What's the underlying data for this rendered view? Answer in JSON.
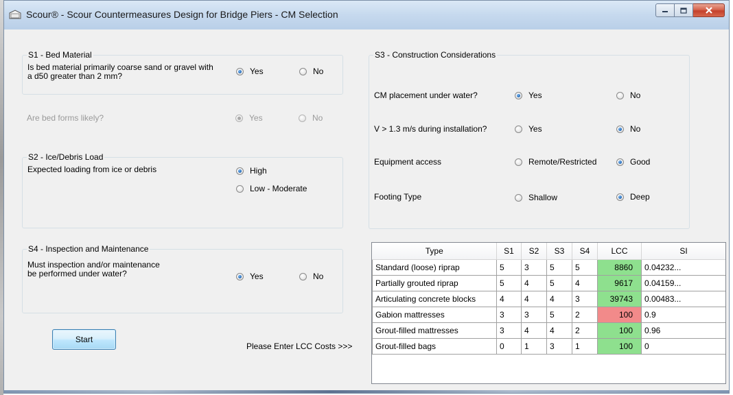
{
  "window": {
    "title": "Scour® - Scour Countermeasures Design for Bridge Piers  - CM Selection"
  },
  "s1": {
    "legend": "S1 - Bed Material",
    "question_line1": "Is bed material primarily coarse sand or gravel with",
    "question_line2": "a d50 greater than 2 mm?",
    "yes": "Yes",
    "no": "No",
    "selected": "Yes",
    "bedforms_question": "Are bed forms likely?",
    "bedforms_yes": "Yes",
    "bedforms_no": "No",
    "bedforms_selected": "Yes",
    "bedforms_enabled": false
  },
  "s2": {
    "legend": "S2 - Ice/Debris Load",
    "question": "Expected loading from ice or debris",
    "high": "High",
    "low": "Low - Moderate",
    "selected": "High"
  },
  "s3": {
    "legend": "S3 - Construction Considerations",
    "q1": "CM placement under water?",
    "q1_yes": "Yes",
    "q1_no": "No",
    "q1_selected": "Yes",
    "q2": "V > 1.3 m/s during installation?",
    "q2_yes": "Yes",
    "q2_no": "No",
    "q2_selected": "No",
    "q3": "Equipment access",
    "q3_opt1": "Remote/Restricted",
    "q3_opt2": "Good",
    "q3_selected": "Good",
    "q4": "Footing Type",
    "q4_opt1": "Shallow",
    "q4_opt2": "Deep",
    "q4_selected": "Deep"
  },
  "s4": {
    "legend": "S4 - Inspection and Maintenance",
    "question_line1": "Must inspection and/or maintenance",
    "question_line2": "be performed under water?",
    "yes": "Yes",
    "no": "No",
    "selected": "Yes"
  },
  "buttons": {
    "start": "Start"
  },
  "lcc_prompt": "Please Enter LCC Costs  >>>",
  "grid": {
    "columns": [
      "Type",
      "S1",
      "S2",
      "S3",
      "S4",
      "LCC",
      "SI"
    ],
    "rows": [
      {
        "type": "Standard (loose) riprap",
        "s1": "5",
        "s2": "3",
        "s3": "5",
        "s4": "5",
        "lcc": "8860",
        "si": "0.04232...",
        "lcc_color": "#8ee08e"
      },
      {
        "type": "Partially grouted riprap",
        "s1": "5",
        "s2": "4",
        "s3": "5",
        "s4": "4",
        "lcc": "9617",
        "si": "0.04159...",
        "lcc_color": "#8ee08e"
      },
      {
        "type": "Articulating concrete blocks",
        "s1": "4",
        "s2": "4",
        "s3": "4",
        "s4": "3",
        "lcc": "39743",
        "si": "0.00483...",
        "lcc_color": "#8ee08e"
      },
      {
        "type": "Gabion mattresses",
        "s1": "3",
        "s2": "3",
        "s3": "5",
        "s4": "2",
        "lcc": "100",
        "si": "0.9",
        "lcc_color": "#f28a8a"
      },
      {
        "type": "Grout-filled mattresses",
        "s1": "3",
        "s2": "4",
        "s3": "4",
        "s4": "2",
        "lcc": "100",
        "si": "0.96",
        "lcc_color": "#8ee08e"
      },
      {
        "type": "Grout-filled bags",
        "s1": "0",
        "s2": "1",
        "s3": "3",
        "s4": "1",
        "lcc": "100",
        "si": "0",
        "lcc_color": "#8ee08e"
      }
    ]
  }
}
